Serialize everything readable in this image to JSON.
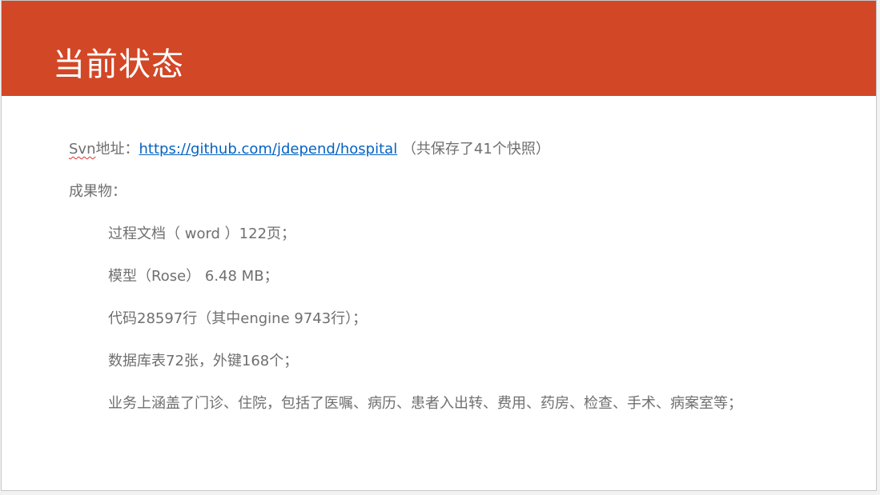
{
  "title": "当前状态",
  "svn": {
    "word": "Svn",
    "label_rest": "地址：",
    "url": "https://github.com/jdepend/hospital",
    "note": "（共保存了41个快照）"
  },
  "deliverables_heading": "成果物：",
  "items": [
    "过程文档（ word ）122页；",
    "模型（Rose） 6.48 MB；",
    "代码28597行（其中engine 9743行）；",
    "数据库表72张，外键168个；",
    "业务上涵盖了门诊、住院，包括了医嘱、病历、患者入出转、费用、药房、检查、手术、病案室等；"
  ],
  "colors": {
    "header": "#d24726",
    "body_text": "#6f6f6f",
    "link": "#0563c1"
  }
}
